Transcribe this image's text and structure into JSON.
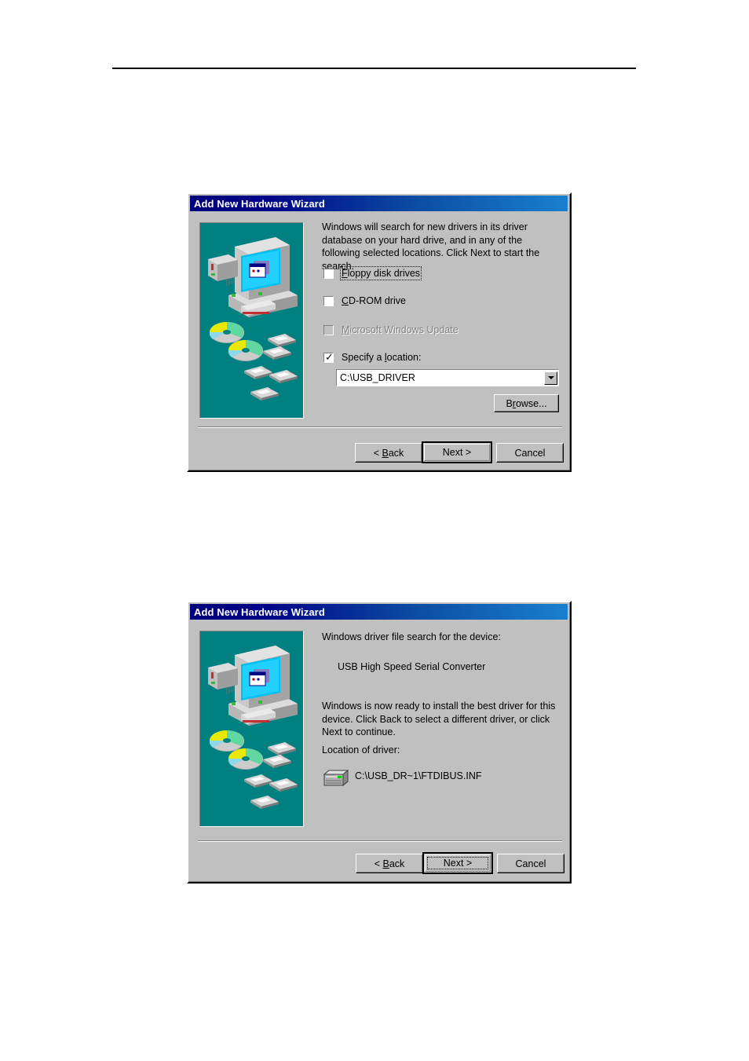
{
  "page": {
    "rule": "horizontal-rule"
  },
  "dialog1": {
    "title": "Add New Hardware Wizard",
    "intro": "Windows will search for new drivers in its driver database on your hard drive, and in any of the following selected locations. Click Next to start the search.",
    "options": [
      {
        "label": "Floppy disk drives",
        "mnemonic": "F",
        "checked": false,
        "disabled": false,
        "focused": true
      },
      {
        "label": "CD-ROM drive",
        "mnemonic": "C",
        "checked": false,
        "disabled": false,
        "focused": false
      },
      {
        "label": "Microsoft Windows Update",
        "mnemonic": "M",
        "checked": false,
        "disabled": true,
        "focused": false
      },
      {
        "label": "Specify a location:",
        "mnemonic": "l",
        "checked": true,
        "disabled": false,
        "focused": false
      }
    ],
    "location_combo": {
      "value": "C:\\USB_DRIVER",
      "arrow_icon": "chevron-down-icon"
    },
    "browse_button": "Browse...",
    "buttons": {
      "back": "< Back",
      "next": "Next >",
      "cancel": "Cancel"
    },
    "graphic": "computer-with-media-illustration"
  },
  "dialog2": {
    "title": "Add New Hardware Wizard",
    "search_label": "Windows driver file search for the device:",
    "device_name": "USB High Speed Serial Converter",
    "ready_text": "Windows is now ready to install the best driver for this device. Click Back to select a different driver, or click Next to continue.",
    "location_label": "Location of driver:",
    "driver_path": "C:\\USB_DR~1\\FTDIBUS.INF",
    "driver_icon": "disk-drive-icon",
    "buttons": {
      "back": "< Back",
      "next": "Next >",
      "cancel": "Cancel"
    },
    "graphic": "computer-with-media-illustration"
  },
  "colors": {
    "dialog_face": "#c0c0c0",
    "title_start": "#00007b",
    "title_end": "#1a7fcf",
    "graphic_teal": "#008080",
    "disabled_text": "#808080"
  }
}
